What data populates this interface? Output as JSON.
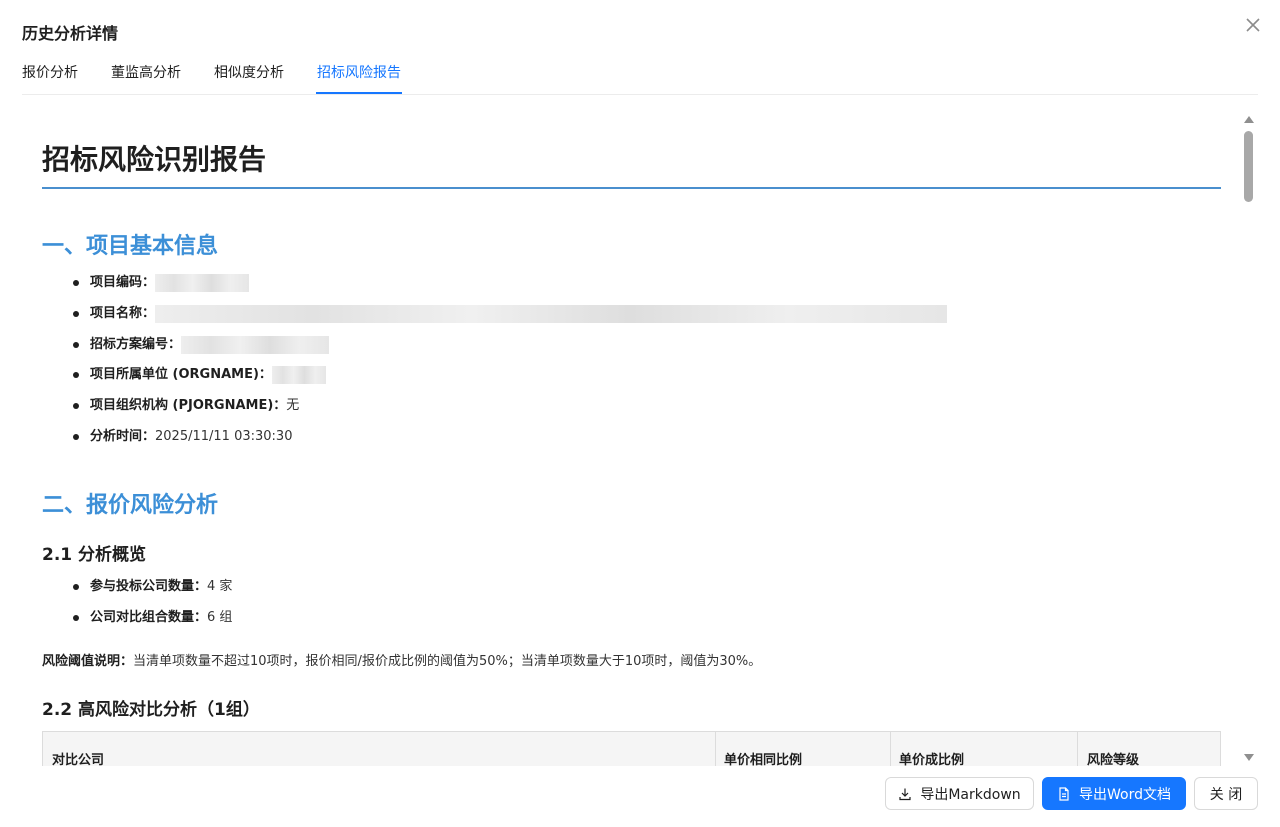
{
  "dialog": {
    "title": "历史分析详情",
    "close_icon": "close-icon"
  },
  "tabs": [
    {
      "label": "报价分析",
      "active": false
    },
    {
      "label": "董监高分析",
      "active": false
    },
    {
      "label": "相似度分析",
      "active": false
    },
    {
      "label": "招标风险报告",
      "active": true
    }
  ],
  "report": {
    "title": "招标风险识别报告",
    "section1": {
      "heading": "一、项目基本信息",
      "items": [
        {
          "label": "项目编码：",
          "value": ""
        },
        {
          "label": "项目名称：",
          "value": ""
        },
        {
          "label": "招标方案编号：",
          "value": ""
        },
        {
          "label": "项目所属单位 (ORGNAME)：",
          "value": ""
        },
        {
          "label": "项目组织机构 (PJORGNAME)：",
          "value": "无"
        },
        {
          "label": "分析时间：",
          "value": "2025/11/11 03:30:30"
        }
      ]
    },
    "section2": {
      "heading": "二、报价风险分析",
      "sub1": {
        "heading": "2.1 分析概览",
        "items": [
          {
            "label": "参与投标公司数量：",
            "value": "4 家"
          },
          {
            "label": "公司对比组合数量：",
            "value": "6 组"
          }
        ]
      },
      "note": {
        "label": "风险阈值说明：",
        "text": "当清单项数量不超过10项时，报价相同/报价成比例的阈值为50%；当清单项数量大于10项时，阈值为30%。"
      },
      "sub2": {
        "heading": "2.2 高风险对比分析（1组）",
        "table_headers": [
          "对比公司",
          "单价相同比例",
          "单价成比例",
          "风险等级"
        ]
      }
    }
  },
  "footer": {
    "export_markdown": "导出Markdown",
    "export_word": "导出Word文档",
    "close": "关 闭",
    "colors": {
      "primary": "#1677ff",
      "heading": "#3c8fd7"
    }
  }
}
